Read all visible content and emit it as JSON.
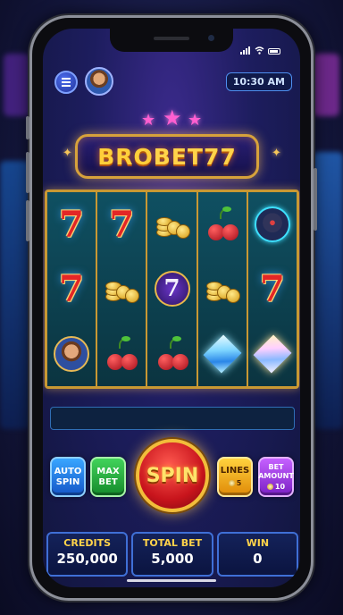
{
  "status": {
    "signal-icon": "signal-icon",
    "wifi-icon": "wifi-icon",
    "battery-icon": "battery-icon"
  },
  "header": {
    "time": "10:30 AM",
    "menu_icon": "menu-icon",
    "avatar": "player-avatar"
  },
  "logo": {
    "part1": "BRO",
    "part2": "BET77"
  },
  "reels": [
    [
      "seven-red",
      "seven-red",
      "face-token"
    ],
    [
      "seven-red",
      "coin-stack",
      "cherry"
    ],
    [
      "coin-stack",
      "seven-purple-token",
      "cherry"
    ],
    [
      "cherry",
      "coin-stack",
      "diamond-blue"
    ],
    [
      "beast-token",
      "seven-red",
      "diamond-gold"
    ]
  ],
  "symbol_text": {
    "seven": "7"
  },
  "controls": {
    "auto_spin": [
      "AUTO",
      "SPIN"
    ],
    "max_bet": [
      "MAX",
      "BET"
    ],
    "spin": "SPIN",
    "lines_label": "LINES",
    "lines_value": "5",
    "bet_amount": [
      "BET",
      "AMOUNT"
    ],
    "bet_amount_value": "10"
  },
  "stats": {
    "credits_label": "CREDITS",
    "credits_value": "250,000",
    "total_bet_label": "TOTAL BET",
    "total_bet_value": "5,000",
    "win_label": "WIN",
    "win_value": "0"
  },
  "colors": {
    "accent_gold": "#ffd34a",
    "reel_frame": "#c99833",
    "spin_red": "#c8141c"
  }
}
